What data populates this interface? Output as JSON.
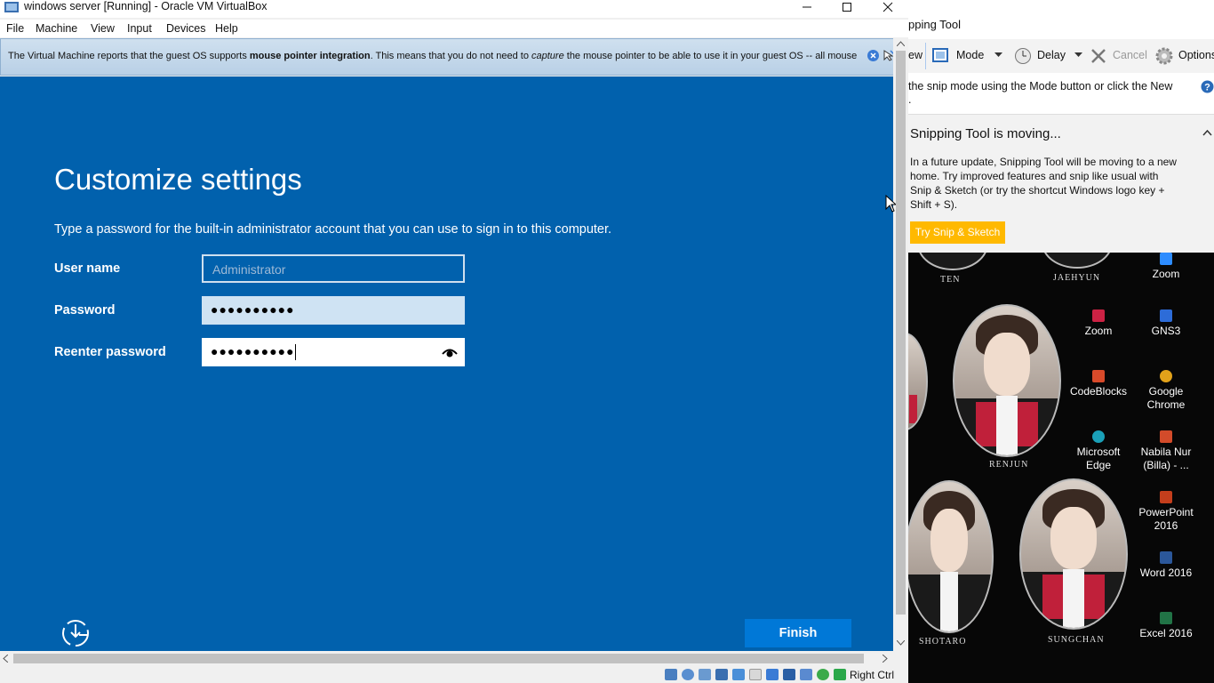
{
  "window": {
    "title": "windows server [Running] - Oracle VM VirtualBox",
    "menu": [
      "File",
      "Machine",
      "View",
      "Input",
      "Devices",
      "Help"
    ]
  },
  "infobar": {
    "part1": "The Virtual Machine reports that the guest OS supports ",
    "bold": "mouse pointer integration",
    "part2": ". This means that you do not need to ",
    "italic": "capture",
    "part3": " the mouse pointer to be able to use it in your guest OS -- all mouse"
  },
  "setup": {
    "heading": "Customize settings",
    "description": "Type a password for the built-in administrator account that you can use to sign in to this computer.",
    "username_label": "User name",
    "username_placeholder": "Administrator",
    "password_label": "Password",
    "password_value": "●●●●●●●●●●",
    "reenter_label": "Reenter password",
    "reenter_value": "●●●●●●●●●●",
    "finish_label": "Finish"
  },
  "statusbar": {
    "host_key": "Right Ctrl"
  },
  "snipping_tool": {
    "title": "pping Tool",
    "new_partial": "ew",
    "mode_label": "Mode",
    "delay_label": "Delay",
    "cancel_label": "Cancel",
    "options_label": "Options",
    "hint_line1": "the snip mode using the Mode button or click the New",
    "hint_line2": ".",
    "panel_title": "Snipping Tool is moving...",
    "panel_body": "In a future update, Snipping Tool will be moving to a new home. Try improved features and snip like usual with Snip & Sketch (or try the shortcut Windows logo key + Shift + S).",
    "try_button": "Try Snip & Sketch"
  },
  "desktop": {
    "photo_names": [
      "TEN",
      "JAEHYUN",
      "RENJUN",
      "SHOTARO",
      "SUNGCHAN"
    ],
    "icons": [
      {
        "label": "Zoom",
        "color": "#2d8cff"
      },
      {
        "label": "Zoom",
        "color": "#cc2244"
      },
      {
        "label": "GNS3",
        "color": "#2d6cd8"
      },
      {
        "label": "CodeBlocks",
        "color": "#d84a2a"
      },
      {
        "label": "Google Chrome",
        "color": "#e2a21a"
      },
      {
        "label": "Microsoft Edge",
        "color": "#1aa0b8"
      },
      {
        "label": "Nabila Nur (Billa) - ...",
        "color": "#d34b2a"
      },
      {
        "label": "PowerPoint 2016",
        "color": "#c43e1c"
      },
      {
        "label": "Word 2016",
        "color": "#2b579a"
      },
      {
        "label": "Excel 2016",
        "color": "#217346"
      }
    ]
  }
}
